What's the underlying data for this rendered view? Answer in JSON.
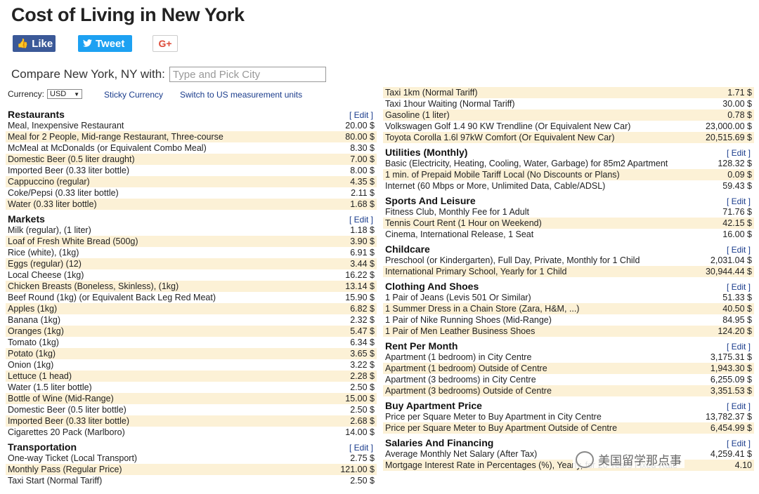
{
  "page": {
    "title": "Cost of Living in New York",
    "like_label": "Like",
    "tweet_label": "Tweet",
    "gplus_label": "G+",
    "compare_label": "Compare New York, NY with:",
    "compare_placeholder": "Type and Pick City",
    "currency_label": "Currency:",
    "currency_value": "USD",
    "sticky_currency": "Sticky Currency",
    "switch_units": "Switch to US measurement units",
    "edit_label": "[ Edit ]",
    "watermark": "美国留学那点事"
  },
  "left": [
    {
      "name": "Restaurants",
      "items": [
        [
          "Meal, Inexpensive Restaurant",
          "20.00 $"
        ],
        [
          "Meal for 2 People, Mid-range Restaurant, Three-course",
          "80.00 $"
        ],
        [
          "McMeal at McDonalds (or Equivalent Combo Meal)",
          "8.30 $"
        ],
        [
          "Domestic Beer (0.5 liter draught)",
          "7.00 $"
        ],
        [
          "Imported Beer (0.33 liter bottle)",
          "8.00 $"
        ],
        [
          "Cappuccino (regular)",
          "4.35 $"
        ],
        [
          "Coke/Pepsi (0.33 liter bottle)",
          "2.11 $"
        ],
        [
          "Water (0.33 liter bottle)",
          "1.68 $"
        ]
      ]
    },
    {
      "name": "Markets",
      "items": [
        [
          "Milk (regular), (1 liter)",
          "1.18 $"
        ],
        [
          "Loaf of Fresh White Bread (500g)",
          "3.90 $"
        ],
        [
          "Rice (white), (1kg)",
          "6.91 $"
        ],
        [
          "Eggs (regular) (12)",
          "3.44 $"
        ],
        [
          "Local Cheese (1kg)",
          "16.22 $"
        ],
        [
          "Chicken Breasts (Boneless, Skinless), (1kg)",
          "13.14 $"
        ],
        [
          "Beef Round (1kg) (or Equivalent Back Leg Red Meat)",
          "15.90 $"
        ],
        [
          "Apples (1kg)",
          "6.82 $"
        ],
        [
          "Banana (1kg)",
          "2.32 $"
        ],
        [
          "Oranges (1kg)",
          "5.47 $"
        ],
        [
          "Tomato (1kg)",
          "6.34 $"
        ],
        [
          "Potato (1kg)",
          "3.65 $"
        ],
        [
          "Onion (1kg)",
          "3.22 $"
        ],
        [
          "Lettuce (1 head)",
          "2.28 $"
        ],
        [
          "Water (1.5 liter bottle)",
          "2.50 $"
        ],
        [
          "Bottle of Wine (Mid-Range)",
          "15.00 $"
        ],
        [
          "Domestic Beer (0.5 liter bottle)",
          "2.50 $"
        ],
        [
          "Imported Beer (0.33 liter bottle)",
          "2.68 $"
        ],
        [
          "Cigarettes 20 Pack (Marlboro)",
          "14.00 $"
        ]
      ]
    },
    {
      "name": "Transportation",
      "items": [
        [
          "One-way Ticket (Local Transport)",
          "2.75 $"
        ],
        [
          "Monthly Pass (Regular Price)",
          "121.00 $"
        ],
        [
          "Taxi Start (Normal Tariff)",
          "2.50 $"
        ]
      ]
    }
  ],
  "right_top": [
    [
      "Taxi 1km (Normal Tariff)",
      "1.71 $"
    ],
    [
      "Taxi 1hour Waiting (Normal Tariff)",
      "30.00 $"
    ],
    [
      "Gasoline (1 liter)",
      "0.78 $"
    ],
    [
      "Volkswagen Golf 1.4 90 KW Trendline (Or Equivalent New Car)",
      "23,000.00 $"
    ],
    [
      "Toyota Corolla 1.6l 97kW Comfort (Or Equivalent New Car)",
      "20,515.69 $"
    ]
  ],
  "right": [
    {
      "name": "Utilities (Monthly)",
      "items": [
        [
          "Basic (Electricity, Heating, Cooling, Water, Garbage) for 85m2 Apartment",
          "128.32 $"
        ],
        [
          "1 min. of Prepaid Mobile Tariff Local (No Discounts or Plans)",
          "0.09 $"
        ],
        [
          "Internet (60 Mbps or More, Unlimited Data, Cable/ADSL)",
          "59.43 $"
        ]
      ]
    },
    {
      "name": "Sports And Leisure",
      "items": [
        [
          "Fitness Club, Monthly Fee for 1 Adult",
          "71.76 $"
        ],
        [
          "Tennis Court Rent (1 Hour on Weekend)",
          "42.15 $"
        ],
        [
          "Cinema, International Release, 1 Seat",
          "16.00 $"
        ]
      ]
    },
    {
      "name": "Childcare",
      "items": [
        [
          "Preschool (or Kindergarten), Full Day, Private, Monthly for 1 Child",
          "2,031.04 $"
        ],
        [
          "International Primary School, Yearly for 1 Child",
          "30,944.44 $"
        ]
      ]
    },
    {
      "name": "Clothing And Shoes",
      "items": [
        [
          "1 Pair of Jeans (Levis 501 Or Similar)",
          "51.33 $"
        ],
        [
          "1 Summer Dress in a Chain Store (Zara, H&M, ...)",
          "40.50 $"
        ],
        [
          "1 Pair of Nike Running Shoes (Mid-Range)",
          "84.95 $"
        ],
        [
          "1 Pair of Men Leather Business Shoes",
          "124.20 $"
        ]
      ]
    },
    {
      "name": "Rent Per Month",
      "items": [
        [
          "Apartment (1 bedroom) in City Centre",
          "3,175.31 $"
        ],
        [
          "Apartment (1 bedroom) Outside of Centre",
          "1,943.30 $"
        ],
        [
          "Apartment (3 bedrooms) in City Centre",
          "6,255.09 $"
        ],
        [
          "Apartment (3 bedrooms) Outside of Centre",
          "3,351.53 $"
        ]
      ]
    },
    {
      "name": "Buy Apartment Price",
      "items": [
        [
          "Price per Square Meter to Buy Apartment in City Centre",
          "13,782.37 $"
        ],
        [
          "Price per Square Meter to Buy Apartment Outside of Centre",
          "6,454.99 $"
        ]
      ]
    },
    {
      "name": "Salaries And Financing",
      "items": [
        [
          "Average Monthly Net Salary (After Tax)",
          "4,259.41 $"
        ],
        [
          "Mortgage Interest Rate in Percentages (%), Yearly, for 20 Years Fixed-Rate",
          "4.10"
        ]
      ]
    }
  ]
}
